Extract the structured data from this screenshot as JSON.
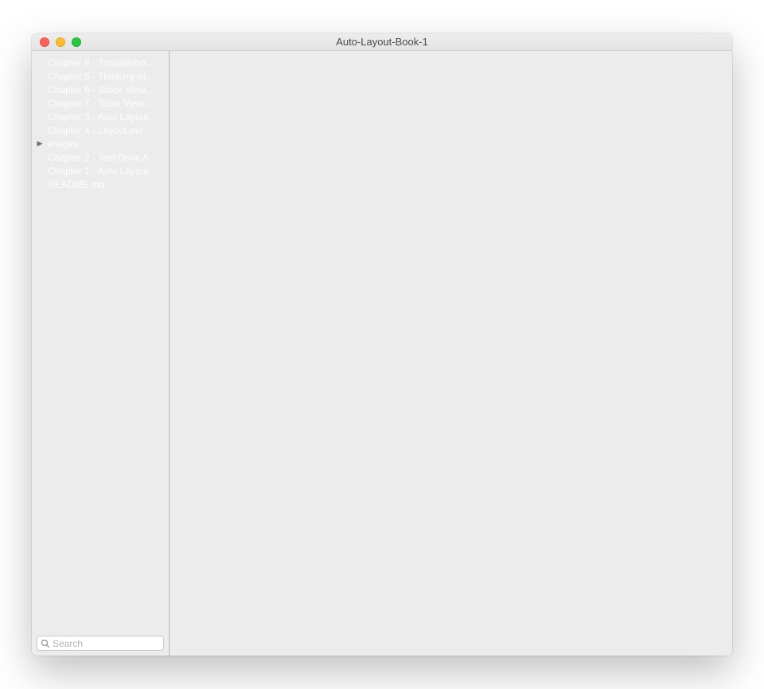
{
  "window": {
    "title": "Auto-Layout-Book-1"
  },
  "sidebar": {
    "items": [
      {
        "label": "Chapter 8 - Troublesho...",
        "folder": false
      },
      {
        "label": "Chapter 5 - Thinking wi...",
        "folder": false
      },
      {
        "label": "Chapter 6 - Stack View...",
        "folder": false
      },
      {
        "label": "Chapter 7 - Table View...",
        "folder": false
      },
      {
        "label": "Chapter 3 - Auto Layout...",
        "folder": false
      },
      {
        "label": "Chapter 4 - Layout.md",
        "folder": false
      },
      {
        "label": "images",
        "folder": true
      },
      {
        "label": "Chapter 2 - Test Drive A...",
        "folder": false
      },
      {
        "label": "Chapter 1 - Auto Layout...",
        "folder": false
      },
      {
        "label": "README.md",
        "folder": false
      }
    ]
  },
  "search": {
    "placeholder": "Search"
  }
}
